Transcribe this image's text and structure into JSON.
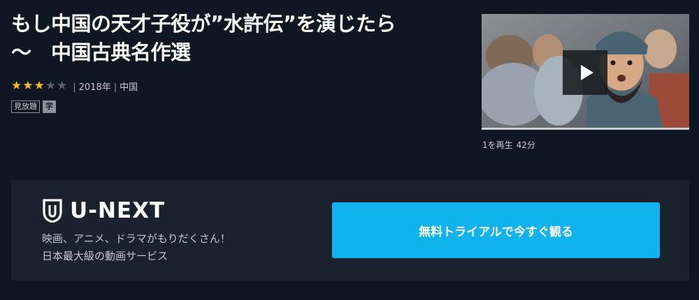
{
  "title": {
    "line1": "もし中国の天才子役が”水許伝”を演じたら",
    "line2": "～　中国古典名作選"
  },
  "rating": {
    "stars_filled": 3,
    "stars_total": 5
  },
  "meta": {
    "year": "2018年",
    "country": "中国"
  },
  "badges": {
    "free": "見放題",
    "subtitle": "字"
  },
  "video": {
    "episode": "1を再生",
    "duration": "42分",
    "progress": 1.0,
    "play_icon": "play-icon"
  },
  "promo": {
    "logo_text": "U-NEXT",
    "logo_icon": "shield-icon",
    "tagline_line1": "映画、アニメ、ドラマがもりだくさん！",
    "tagline_line2": "日本最大級の動画サービス",
    "cta_label": "無料トライアルで今すぐ観る"
  },
  "colors": {
    "background": "#0f1722",
    "panel": "#1a222d",
    "star": "#f5b922",
    "star_off": "#5b616b",
    "cta": "#10b3ee"
  }
}
